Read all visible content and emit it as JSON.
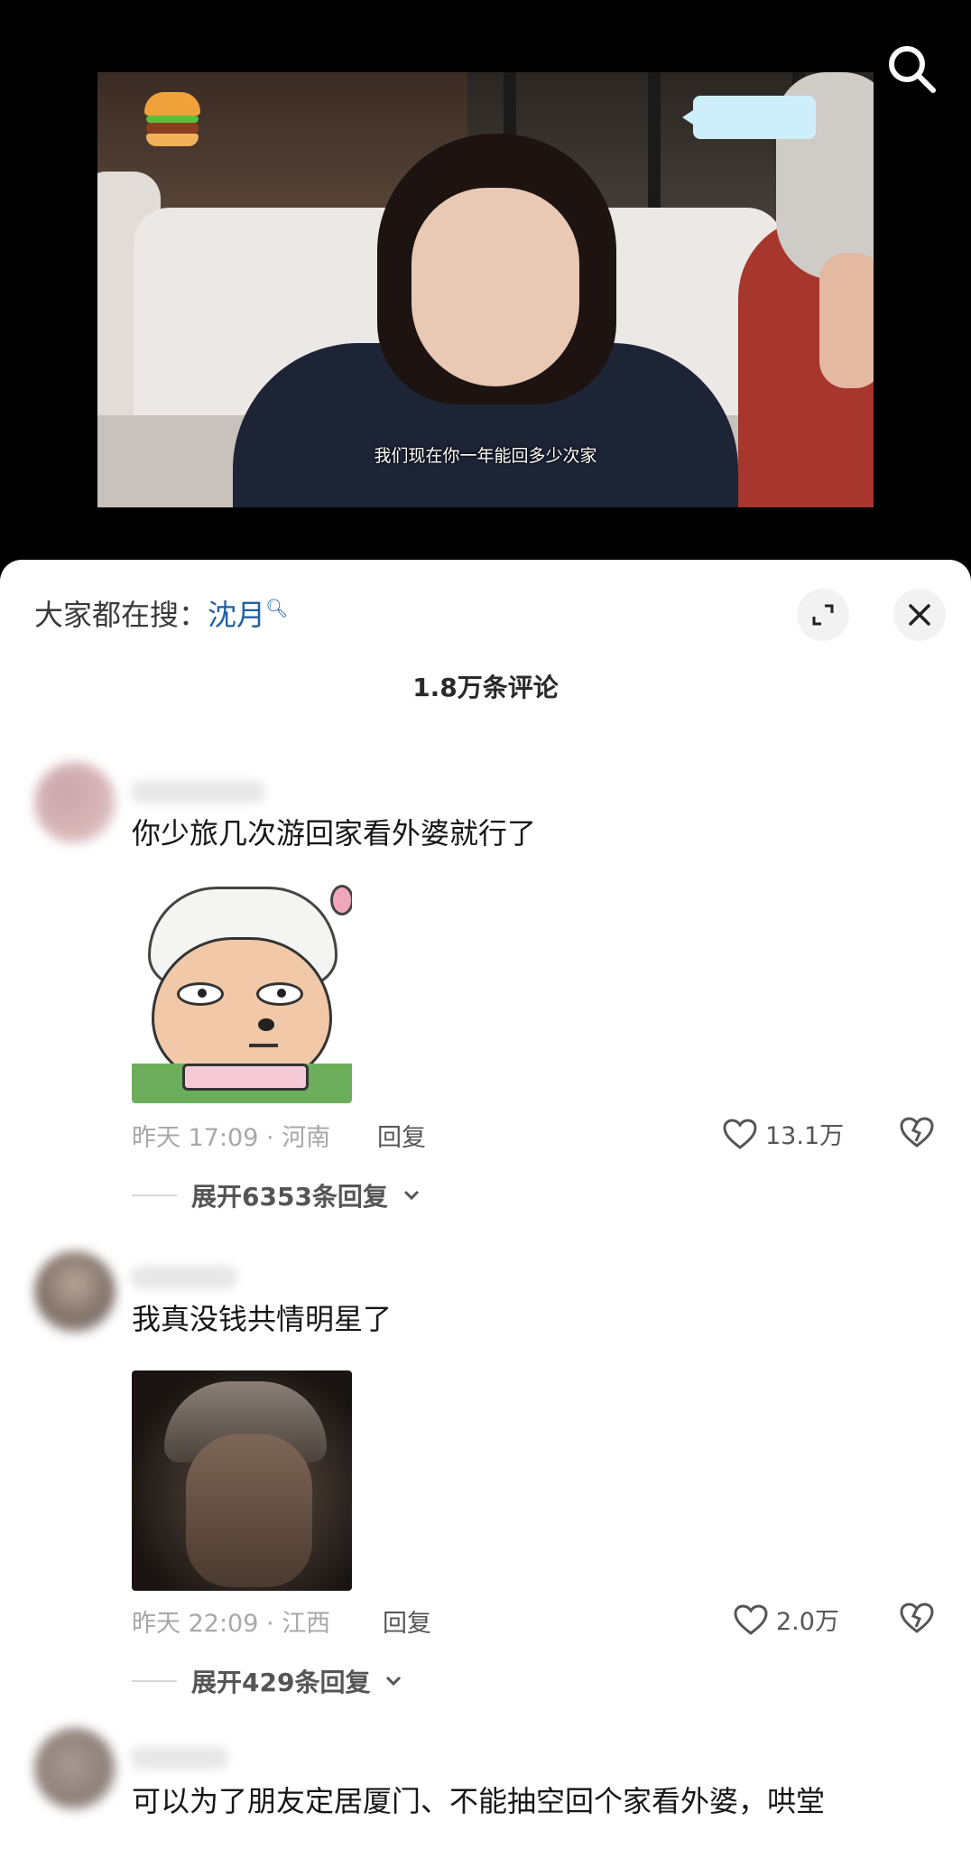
{
  "video": {
    "subtitle": "我们现在你一年能回多少次家",
    "search_icon": "search-icon",
    "logo": "burger-logo"
  },
  "sheet": {
    "trending_prefix": "大家都在搜：",
    "trending_keyword": "沈月",
    "comment_count": "1.8万条评论",
    "expand_icon": "expand-icon",
    "close_icon": "close-icon"
  },
  "comments": [
    {
      "text": "你少旅几次游回家看外婆就行了",
      "image": "cartoon-sheep-sticker",
      "time_location": "昨天 17:09 · 河南",
      "reply_label": "回复",
      "likes": "13.1万",
      "expand_label": "展开6353条回复"
    },
    {
      "text": "我真没钱共情明星了",
      "image": "dark-portrait-sticker",
      "time_location": "昨天 22:09 · 江西",
      "reply_label": "回复",
      "likes": "2.0万",
      "expand_label": "展开429条回复"
    },
    {
      "text": "可以为了朋友定居厦门、不能抽空回个家看外婆，哄堂"
    }
  ],
  "colors": {
    "keyword": "#1f5fa6",
    "meta": "#a8a8a8",
    "sheet_bg": "#ffffff",
    "page_bg": "#000000"
  }
}
